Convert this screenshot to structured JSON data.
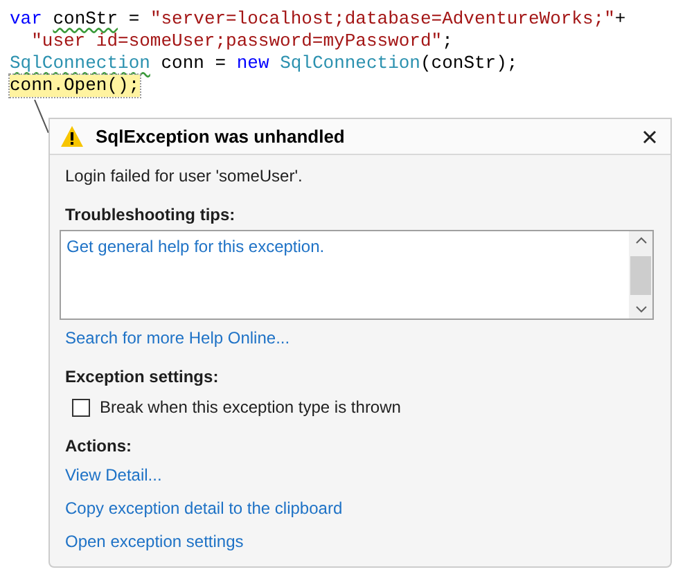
{
  "code_lines": [
    {
      "highlighted": false,
      "tokens": [
        {
          "kind": "keyword",
          "text": "var ",
          "squiggle": false
        },
        {
          "kind": "plain",
          "text": "conStr",
          "squiggle": true
        },
        {
          "kind": "plain",
          "text": " = ",
          "squiggle": false
        },
        {
          "kind": "string",
          "text": "\"server=localhost;database=AdventureWorks;\"",
          "squiggle": false
        },
        {
          "kind": "plain",
          "text": "+",
          "squiggle": false
        }
      ]
    },
    {
      "highlighted": false,
      "tokens": [
        {
          "kind": "string",
          "text": "  \"user id=someUser;password=myPassword\"",
          "squiggle": false
        },
        {
          "kind": "plain",
          "text": ";",
          "squiggle": false
        }
      ]
    },
    {
      "highlighted": false,
      "tokens": [
        {
          "kind": "type",
          "text": "SqlConnection",
          "squiggle": true
        },
        {
          "kind": "plain",
          "text": " conn = ",
          "squiggle": false
        },
        {
          "kind": "keyword",
          "text": "new ",
          "squiggle": false
        },
        {
          "kind": "type",
          "text": "SqlConnection",
          "squiggle": false
        },
        {
          "kind": "plain",
          "text": "(conStr);",
          "squiggle": false
        }
      ]
    },
    {
      "highlighted": true,
      "tokens": [
        {
          "kind": "plain",
          "text": "conn.Open();",
          "squiggle": false
        }
      ]
    }
  ],
  "popup": {
    "title": "SqlException was unhandled",
    "message": "Login failed for user 'someUser'.",
    "troubleshooting": {
      "heading": "Troubleshooting tips:",
      "tips": [
        "Get general help for this exception."
      ]
    },
    "help_link": "Search for more Help Online...",
    "exception_settings": {
      "heading": "Exception settings:",
      "checkbox": {
        "label": "Break when this exception type is thrown",
        "checked": false
      }
    },
    "actions": {
      "heading": "Actions:",
      "links": [
        "View Detail...",
        "Copy exception detail to the clipboard",
        "Open exception settings"
      ]
    }
  }
}
